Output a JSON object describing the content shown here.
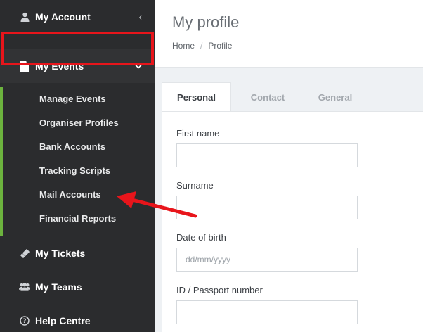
{
  "sidebar": {
    "account": {
      "label": "My Account",
      "icon": "user-icon"
    },
    "events": {
      "label": "My Events",
      "icon": "file-icon"
    },
    "events_sub": [
      {
        "label": "Manage Events"
      },
      {
        "label": "Organiser Profiles"
      },
      {
        "label": "Bank Accounts"
      },
      {
        "label": "Tracking Scripts"
      },
      {
        "label": "Mail Accounts"
      },
      {
        "label": "Financial Reports"
      }
    ],
    "tickets": {
      "label": "My Tickets",
      "icon": "ticket-icon"
    },
    "teams": {
      "label": "My Teams",
      "icon": "users-icon"
    },
    "help": {
      "label": "Help Centre",
      "icon": "question-circle-icon"
    }
  },
  "header": {
    "title": "My profile",
    "breadcrumb": {
      "home": "Home",
      "sep": "/",
      "current": "Profile"
    }
  },
  "tabs": [
    {
      "label": "Personal",
      "active": true
    },
    {
      "label": "Contact",
      "active": false
    },
    {
      "label": "General",
      "active": false
    }
  ],
  "form": {
    "first_name": {
      "label": "First name",
      "value": ""
    },
    "surname": {
      "label": "Surname",
      "value": ""
    },
    "dob": {
      "label": "Date of birth",
      "placeholder": "dd/mm/yyyy"
    },
    "id_number": {
      "label": "ID / Passport number",
      "value": ""
    }
  },
  "colors": {
    "sidebar_bg": "#2b2c2e",
    "highlight_red": "#e8151b",
    "accent_green": "#6cb33e"
  }
}
